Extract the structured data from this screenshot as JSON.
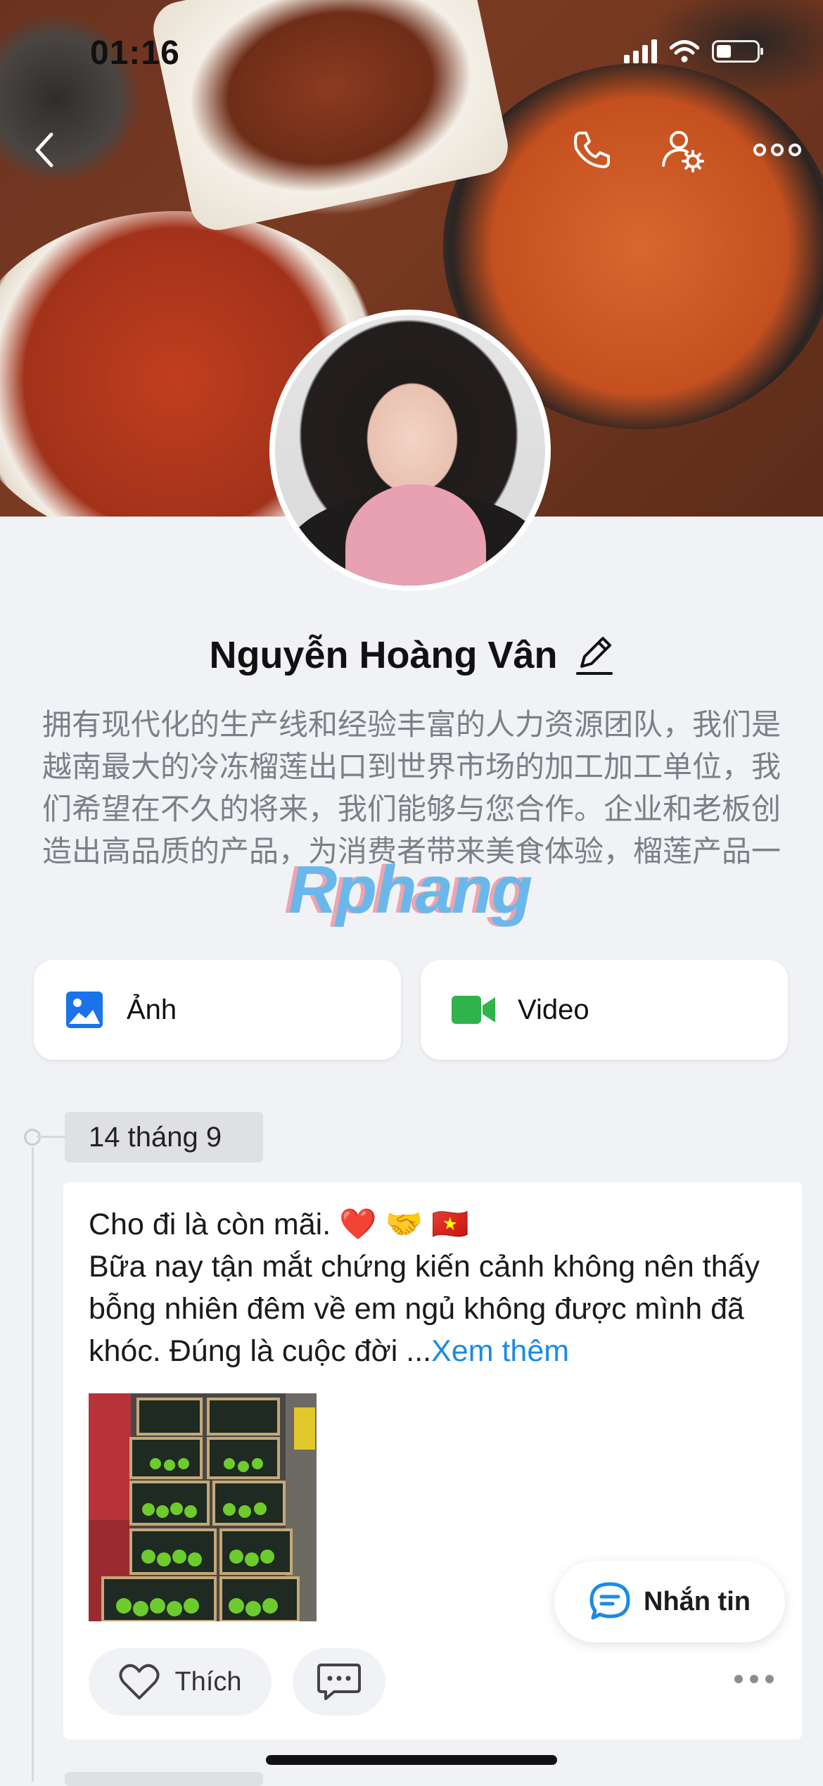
{
  "status_bar": {
    "time": "01:16"
  },
  "profile": {
    "name": "Nguyễn Hoàng Vân",
    "bio": "拥有现代化的生产线和经验丰富的人力资源团队，我们是越南最大的冷冻榴莲出口到世界市场的加工加工单位，我们希望在不久的将来，我们能够与您合作。企业和老板创造出高品质的产品，为消费者带来美食体验，榴莲产品一"
  },
  "watermark": "Rphang",
  "media_buttons": {
    "photo_label": "Ảnh",
    "video_label": "Video"
  },
  "timeline": {
    "date": "14 tháng 9",
    "post": {
      "text": "Cho đi là còn mãi. ❤️ 🤝 🇻🇳\nBữa nay tận mắt chứng kiến cảnh không nên thấy bỗng nhiên đêm về em ngủ không được mình đã khóc. Đúng là cuộc đời ...",
      "see_more": "Xem thêm",
      "like_label": "Thích"
    }
  },
  "message_button": {
    "label": "Nhắn tin"
  },
  "colors": {
    "accent": "#1a8ae6",
    "video_green": "#2fb34a",
    "photo_blue": "#1a73e8"
  }
}
